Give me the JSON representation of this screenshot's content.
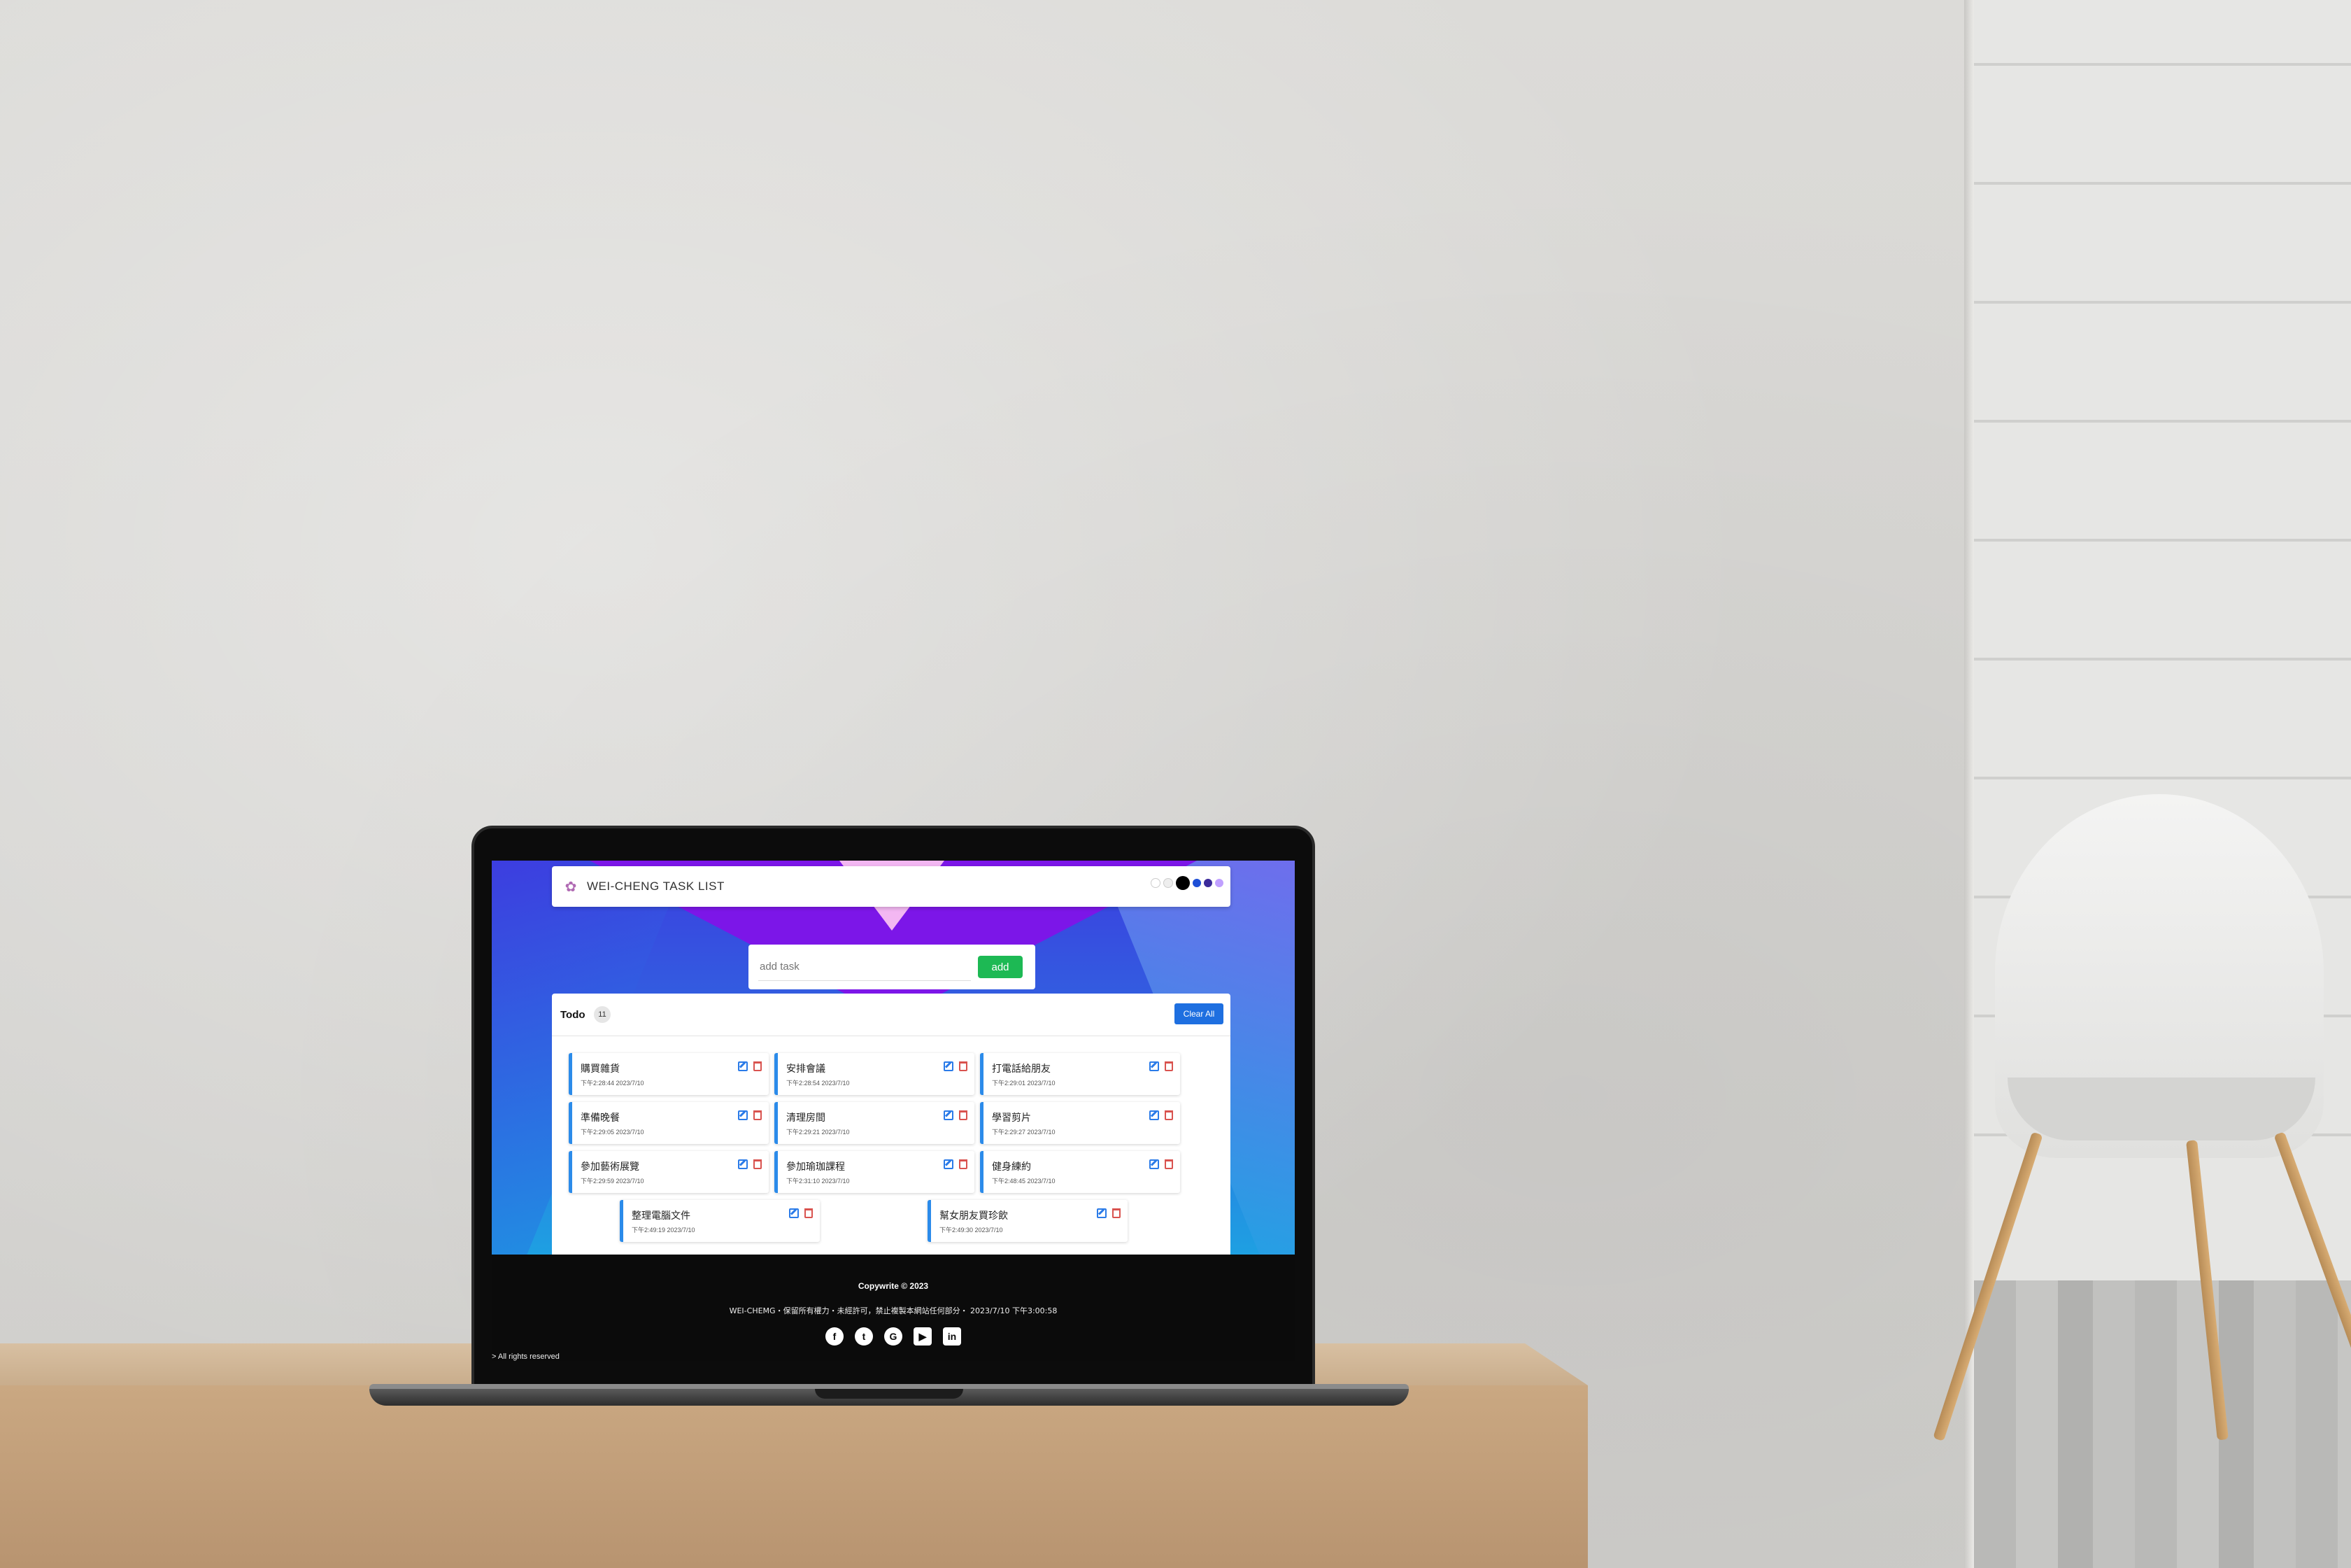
{
  "app": {
    "brand": "WEI-CHENG TASK LIST"
  },
  "theme_swatches": [
    "#ffffff",
    "#eeeeee",
    "#000000",
    "#1e4fd6",
    "#3b2a9a",
    "#c0a0ff"
  ],
  "add_task": {
    "placeholder": "add task",
    "button_label": "add"
  },
  "todo": {
    "title": "Todo",
    "count": "11",
    "clear_label": "Clear All",
    "tasks": [
      {
        "name": "購買雜貨",
        "time": "下午2:28:44 2023/7/10"
      },
      {
        "name": "安排會議",
        "time": "下午2:28:54 2023/7/10"
      },
      {
        "name": "打電話給朋友",
        "time": "下午2:29:01 2023/7/10"
      },
      {
        "name": "準備晚餐",
        "time": "下午2:29:05 2023/7/10"
      },
      {
        "name": "清理房間",
        "time": "下午2:29:21 2023/7/10"
      },
      {
        "name": "學習剪片",
        "time": "下午2:29:27 2023/7/10"
      },
      {
        "name": "參加藝術展覽",
        "time": "下午2:29:59 2023/7/10"
      },
      {
        "name": "參加瑜珈課程",
        "time": "下午2:31:10 2023/7/10"
      },
      {
        "name": "健身練約",
        "time": "下午2:48:45 2023/7/10"
      },
      {
        "name": "整理電腦文件",
        "time": "下午2:49:19 2023/7/10"
      },
      {
        "name": "幫女朋友買珍飲",
        "time": "下午2:49:30 2023/7/10"
      }
    ]
  },
  "footer": {
    "copyright": "Copywrite © 2023",
    "rights_line": "WEI-CHEMG・保留所有權力・未經許可，禁止複製本網站任何部分・ 2023/7/10 下午3:00:58",
    "all_rights": "> All rights reserved",
    "socials": [
      {
        "name": "facebook-icon",
        "glyph": "f"
      },
      {
        "name": "twitter-icon",
        "glyph": "t"
      },
      {
        "name": "google-icon",
        "glyph": "G"
      },
      {
        "name": "youtube-icon",
        "glyph": "▶"
      },
      {
        "name": "linkedin-icon",
        "glyph": "in"
      }
    ]
  }
}
